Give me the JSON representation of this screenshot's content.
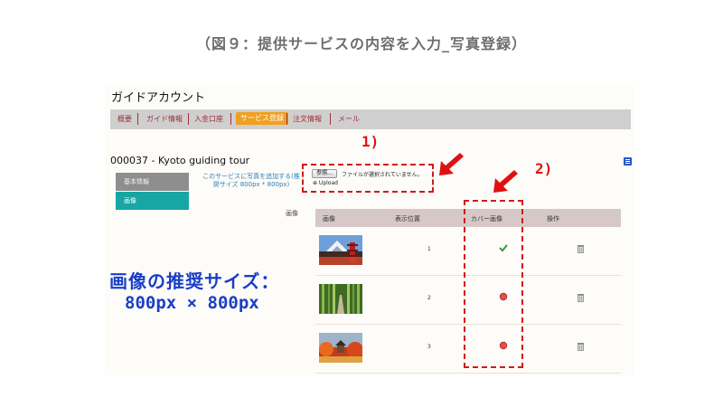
{
  "slide": {
    "title": "（図９：提供サービスの内容を入力_写真登録）"
  },
  "app": {
    "account_title": "ガイドアカウント"
  },
  "nav": {
    "items": [
      {
        "label": "概要"
      },
      {
        "label": "ガイド情報"
      },
      {
        "label": "入金口座"
      },
      {
        "label": "サービス登録",
        "active": true
      },
      {
        "label": "注文情報"
      },
      {
        "label": "メール"
      }
    ]
  },
  "service": {
    "title": "000037 - Kyoto guiding tour"
  },
  "side_nav": {
    "items": [
      {
        "label": "基本情報",
        "active": false
      },
      {
        "label": "画像",
        "active": true
      }
    ]
  },
  "photo_section": {
    "add_text": "このサービスに写真を追加する(推奨サイズ 800px * 800px)",
    "image_label": "画像",
    "browse_label": "参照...",
    "file_none": "ファイルが選択されていません。",
    "upload_label": "⊕ Upload"
  },
  "table": {
    "headers": [
      "画像",
      "表示位置",
      "カバー画像",
      "操作"
    ],
    "rows": [
      {
        "thumbnail": "temple-fuji-photo",
        "order": "1",
        "cover": "check-icon"
      },
      {
        "thumbnail": "bamboo-forest-photo",
        "order": "2",
        "cover": "red-dot-icon"
      },
      {
        "thumbnail": "autumn-temple-photo",
        "order": "3",
        "cover": "red-dot-icon"
      }
    ]
  },
  "annotations": {
    "label_1": "1)",
    "label_2": "2)",
    "size_label": "画像の推奨サイズ：",
    "size_value": "800px × 800px",
    "highlight_color": "#d11a1a",
    "size_color": "#1a3ec8"
  },
  "colors": {
    "nav_active": "#f0a020",
    "side_active": "#17a6a4",
    "side_inactive": "#8e8e8e",
    "table_header": "#d7c8c8"
  }
}
